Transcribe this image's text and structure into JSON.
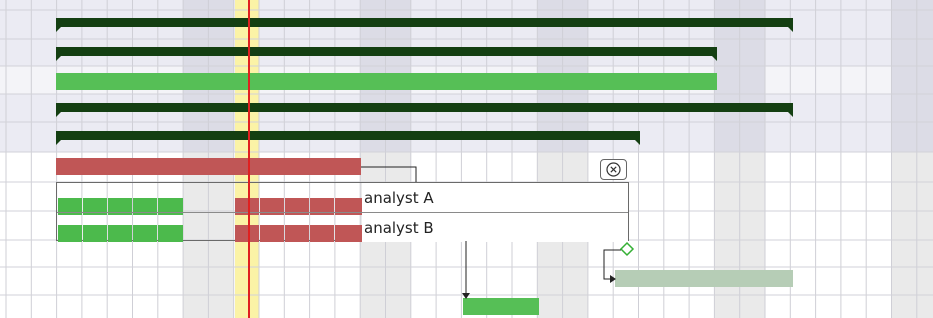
{
  "resources": [
    {
      "label": "analyst A"
    },
    {
      "label": "analyst B"
    }
  ],
  "close_icon": "close-icon",
  "colors": {
    "summary": "#143f12",
    "task_green": "#56bf56",
    "task_red": "#c05656",
    "task_pale": "#b6cdb6",
    "today_line": "#e02020",
    "today_band": "#fbf3a6",
    "milestone": "#35b035"
  }
}
